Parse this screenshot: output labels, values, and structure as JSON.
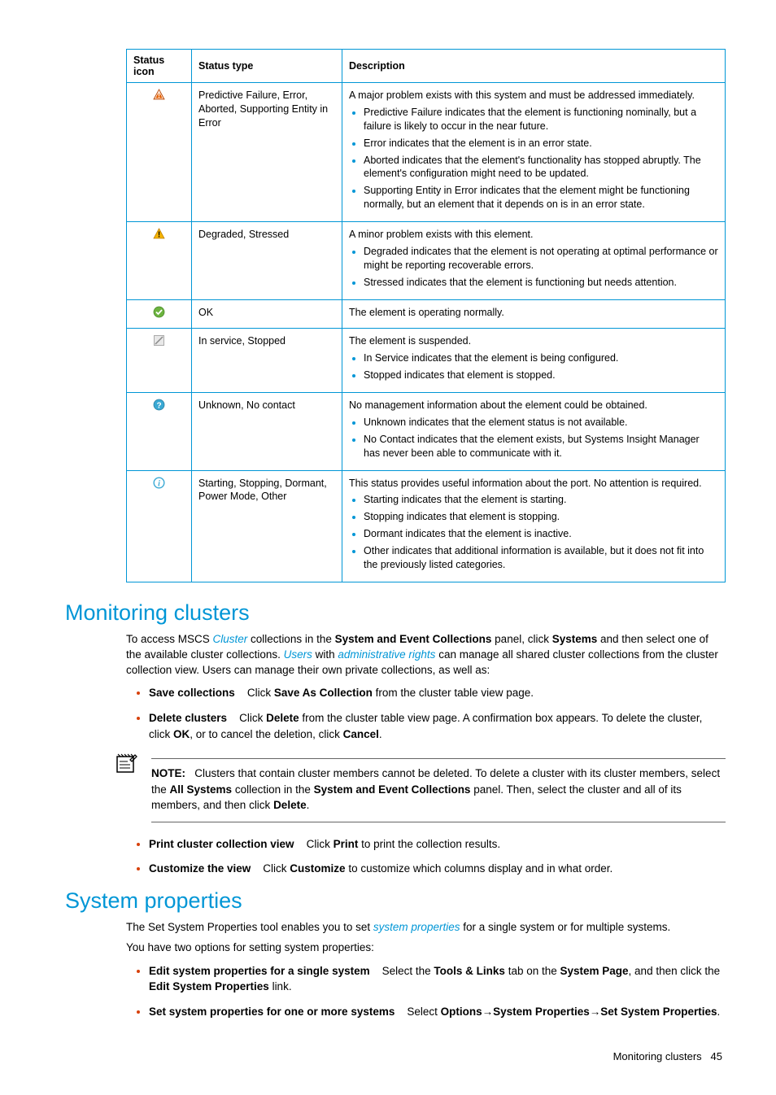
{
  "table": {
    "headers": {
      "icon": "Status icon",
      "type": "Status type",
      "desc": "Description"
    },
    "rows": [
      {
        "icon": "critical",
        "type": "Predictive Failure, Error, Aborted, Supporting Entity in Error",
        "desc_intro": "A major problem exists with this system and must be addressed immediately.",
        "bullets": [
          "Predictive Failure indicates that the element is functioning nominally, but a failure is likely to occur in the near future.",
          "Error indicates that the element is in an error state.",
          "Aborted indicates that the element's functionality has stopped abruptly. The element's configuration might need to be updated.",
          "Supporting Entity in Error indicates that the element might be functioning normally, but an element that it depends on is in an error state."
        ]
      },
      {
        "icon": "warning",
        "type": "Degraded, Stressed",
        "desc_intro": "A minor problem exists with this element.",
        "bullets": [
          "Degraded indicates that the element is not operating at optimal performance or might be reporting recoverable errors.",
          "Stressed indicates that the element is functioning but needs attention."
        ]
      },
      {
        "icon": "ok",
        "type": "OK",
        "desc_intro": "The element is operating normally.",
        "bullets": []
      },
      {
        "icon": "pause",
        "type": "In service, Stopped",
        "desc_intro": "The element is suspended.",
        "bullets": [
          "In Service indicates that the element is being configured.",
          "Stopped indicates that element is stopped."
        ]
      },
      {
        "icon": "unknown",
        "type": "Unknown, No contact",
        "desc_intro": "No management information about the element could be obtained.",
        "bullets": [
          "Unknown indicates that the element status is not available.",
          "No Contact indicates that the element exists, but Systems Insight Manager has never been able to communicate with it."
        ]
      },
      {
        "icon": "info",
        "type": "Starting, Stopping, Dormant, Power Mode, Other",
        "desc_intro": "This status provides useful information about the port. No attention is required.",
        "bullets": [
          "Starting indicates that the element is starting.",
          "Stopping indicates that element is stopping.",
          "Dormant indicates that the element is inactive.",
          "Other indicates that additional information is available, but it does not fit into the previously listed categories."
        ]
      }
    ]
  },
  "sections": {
    "clusters": {
      "heading": "Monitoring clusters",
      "intro_parts": {
        "p1a": "To access MSCS ",
        "p1_cluster": "Cluster",
        "p1b": " collections in the ",
        "p1_panel": "System and Event Collections",
        "p1c": " panel, click ",
        "p1_systems": "Systems",
        "p1d": " and then select one of the available cluster collections. ",
        "p1_users": "Users",
        "p1e": " with ",
        "p1_admin": "administrative rights",
        "p1f": " can manage all shared cluster collections from the cluster collection view. Users can manage their own private collections, as well as:"
      },
      "items": {
        "save": {
          "label": "Save collections",
          "mid": "Click ",
          "bold": "Save As Collection",
          "rest": " from the cluster table view page."
        },
        "delete": {
          "label": "Delete clusters",
          "mid": "Click ",
          "bold": "Delete",
          "rest": " from the cluster table view page. A confirmation box appears. To delete the cluster, click ",
          "bold2": "OK",
          "rest2": ", or to cancel the deletion, click ",
          "bold3": "Cancel",
          "rest3": "."
        },
        "print": {
          "label": "Print cluster collection view",
          "mid": "Click ",
          "bold": "Print",
          "rest": " to print the collection results."
        },
        "custom": {
          "label": "Customize the view",
          "mid": "Click ",
          "bold": "Customize",
          "rest": " to customize which columns display and in what order."
        }
      },
      "note": {
        "label": "NOTE:",
        "t1": "Clusters that contain cluster members cannot be deleted. To delete a cluster with its cluster members, select the ",
        "b1": "All Systems",
        "t2": " collection in the ",
        "b2": "System and Event Collections",
        "t3": " panel. Then, select the cluster and all of its members, and then click ",
        "b3": "Delete",
        "t4": "."
      }
    },
    "sysprops": {
      "heading": "System properties",
      "p1a": "The Set System Properties tool enables you to set ",
      "p1_term": "system properties",
      "p1b": " for a single system or for multiple systems.",
      "p2": "You have two options for setting system properties:",
      "items": {
        "single": {
          "label": "Edit system properties for a single system",
          "t1": "Select the ",
          "b1": "Tools & Links",
          "t2": " tab on the ",
          "b2": "System Page",
          "t3": ", and then click the ",
          "b3": "Edit System Properties",
          "t4": " link."
        },
        "multi": {
          "label": "Set system properties for one or more systems",
          "t1": "Select ",
          "b1": "Options",
          "arrow1": "→",
          "b2": "System Properties",
          "arrow2": "→",
          "b3": "Set System Properties",
          "t2": "."
        }
      }
    }
  },
  "footer": {
    "label": "Monitoring clusters",
    "page": "45"
  }
}
